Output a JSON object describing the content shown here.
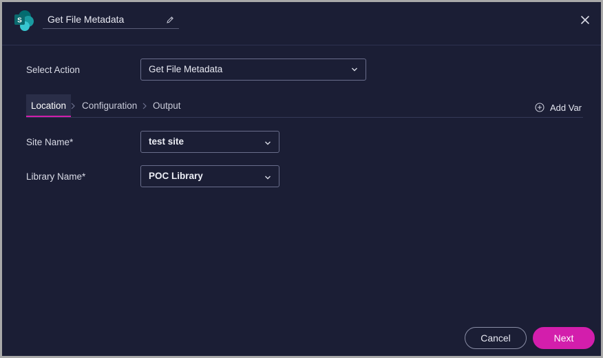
{
  "header": {
    "title": "Get File Metadata",
    "logo_icon": "sharepoint-logo",
    "edit_icon": "pencil-icon",
    "close_icon": "close-icon"
  },
  "select_action": {
    "label": "Select Action",
    "value": "Get File Metadata"
  },
  "tabs": [
    {
      "label": "Location",
      "active": true
    },
    {
      "label": "Configuration",
      "active": false
    },
    {
      "label": "Output",
      "active": false
    }
  ],
  "add_var": {
    "label": "Add Var",
    "icon": "plus-circle-icon"
  },
  "fields": {
    "site_name": {
      "label": "Site Name*",
      "value": "test site"
    },
    "library_name": {
      "label": "Library Name*",
      "value": "POC Library"
    }
  },
  "footer": {
    "cancel_label": "Cancel",
    "next_label": "Next"
  },
  "colors": {
    "background": "#1b1e35",
    "accent": "#d31eac",
    "border": "#6a6e8c"
  }
}
